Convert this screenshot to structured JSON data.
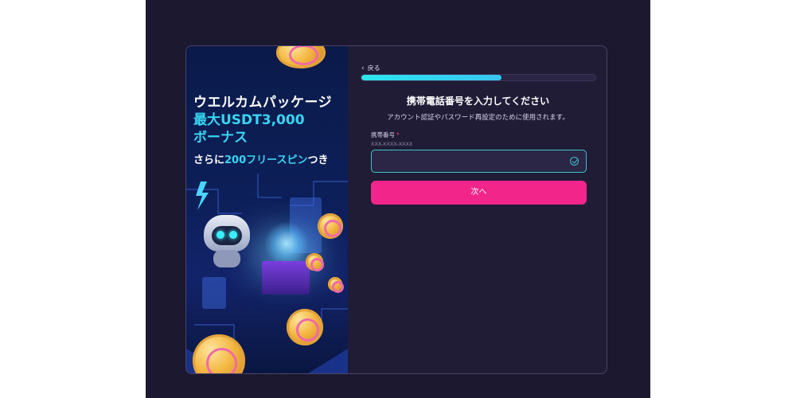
{
  "promo": {
    "headline": "ウエルカムパッケージ",
    "amount": "最大USDT3,000",
    "bonus": "ボーナス",
    "spins_prefix": "さらに",
    "spins_highlight": "200フリースピン",
    "spins_suffix": "つき"
  },
  "form": {
    "back_label": "戻る",
    "progress": 0.6,
    "title": "携帯電話番号を入力してください",
    "subtitle": "アカウント認証やパスワード再設定のために使用されます。",
    "phone_label": "携帯番号",
    "required_mark": "*",
    "phone_hint": "XXX-XXXX-XXXX",
    "phone_value": "",
    "next_label": "次へ"
  },
  "colors": {
    "accent_cyan": "#37d6f2",
    "button_pink": "#f2258b",
    "background": "#1b1830"
  },
  "icons": {
    "back": "chevron-left-icon",
    "input_status": "check-circle-icon"
  }
}
